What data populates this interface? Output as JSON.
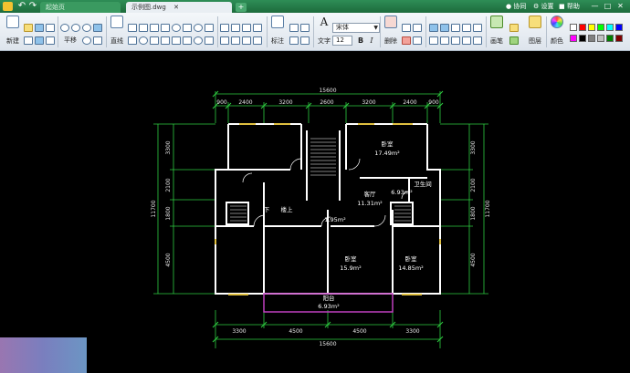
{
  "titlebar": {
    "tabs": [
      {
        "label": "起始页",
        "active": false
      },
      {
        "label": "示例图.dwg",
        "active": true
      }
    ],
    "add_tab": "+",
    "collaborate": "协同",
    "settings": "设置",
    "help": "帮助",
    "window_controls": [
      "—",
      "□",
      "✕"
    ]
  },
  "ribbon": {
    "new_label": "新建",
    "pan_label": "平移",
    "line_label": "直线",
    "dimension_label": "标注",
    "text_label": "文字",
    "font_name": "宋体",
    "font_size": "12",
    "bold": "B",
    "italic": "I",
    "erase_label": "删除",
    "pen_label": "画笔",
    "layers_label": "图层",
    "color_label": "颜色",
    "color_swatches": [
      "#ffffff",
      "#ff0000",
      "#ffff00",
      "#00ff00",
      "#00ffff",
      "#0000ff",
      "#ff00ff",
      "#000000",
      "#808080",
      "#c0c0c0",
      "#008000",
      "#800000"
    ]
  },
  "drawing": {
    "dims_top": [
      "900",
      "2400",
      "3200",
      "2600",
      "3200",
      "2400",
      "900"
    ],
    "overall_width": "15600",
    "dims_bottom": [
      "3300",
      "4500",
      "4500",
      "3300"
    ],
    "dims_left": [
      "3300",
      "2100",
      "1800",
      "4500"
    ],
    "dims_right": [
      "3300",
      "2100",
      "1800",
      "4500"
    ],
    "overall_height": "11700",
    "rooms": [
      {
        "name": "卧室",
        "area": "17.49m²"
      },
      {
        "name": "客厅",
        "area": "11.31m²"
      },
      {
        "name": "",
        "area": "6.93m²"
      },
      {
        "name": "卫生间",
        "area": ""
      },
      {
        "name": "",
        "area": "1.95m²"
      },
      {
        "name": "卧室",
        "area": "15.9m²"
      },
      {
        "name": "卧室",
        "area": "14.85m²"
      },
      {
        "name": "阳台",
        "area": "6.93m²"
      }
    ],
    "stair_labels": [
      "下",
      "楼上"
    ]
  }
}
